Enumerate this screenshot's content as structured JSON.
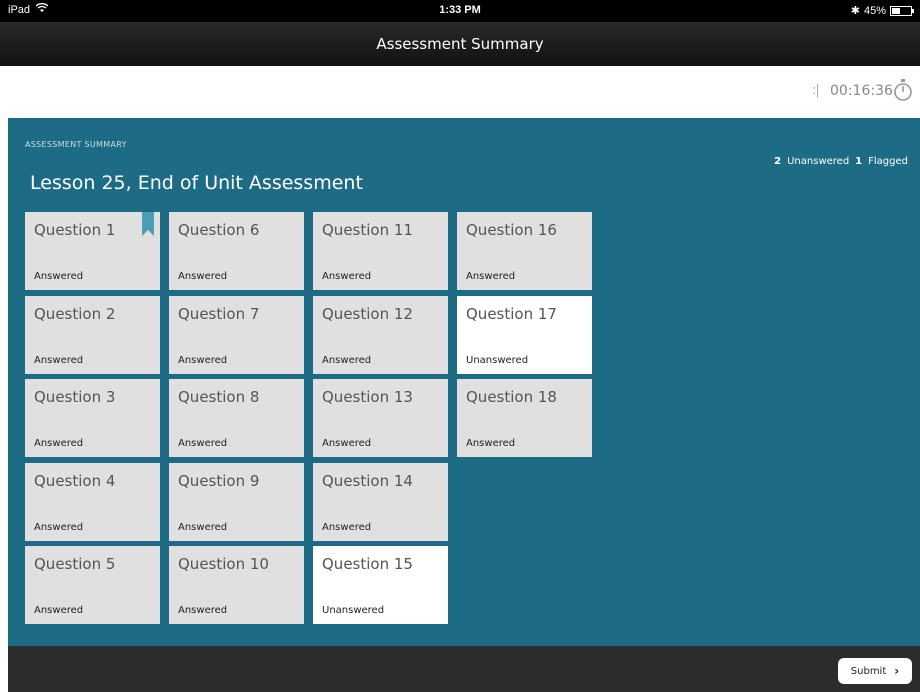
{
  "status_bar": {
    "carrier": "iPad",
    "time": "1:33 PM",
    "battery": "45%",
    "battery_level": 0.45
  },
  "nav": {
    "title": "Assessment Summary"
  },
  "timer": {
    "value": "00:16:36",
    "grip": ":|"
  },
  "main": {
    "section_label": "ASSESSMENT SUMMARY",
    "title": "Lesson 25, End of Unit Assessment",
    "unanswered_count": "2",
    "unanswered_label": "Unanswered",
    "flagged_count": "1",
    "flagged_label": "Flagged"
  },
  "questions": [
    {
      "title": "Question 1",
      "status": "Answered",
      "flagged": true
    },
    {
      "title": "Question 2",
      "status": "Answered"
    },
    {
      "title": "Question 3",
      "status": "Answered"
    },
    {
      "title": "Question 4",
      "status": "Answered"
    },
    {
      "title": "Question 5",
      "status": "Answered"
    },
    {
      "title": "Question 6",
      "status": "Answered"
    },
    {
      "title": "Question 7",
      "status": "Answered"
    },
    {
      "title": "Question 8",
      "status": "Answered"
    },
    {
      "title": "Question 9",
      "status": "Answered"
    },
    {
      "title": "Question 10",
      "status": "Answered"
    },
    {
      "title": "Question 11",
      "status": "Answered"
    },
    {
      "title": "Question 12",
      "status": "Answered"
    },
    {
      "title": "Question 13",
      "status": "Answered"
    },
    {
      "title": "Question 14",
      "status": "Answered"
    },
    {
      "title": "Question 15",
      "status": "Unanswered"
    },
    {
      "title": "Question 16",
      "status": "Answered"
    },
    {
      "title": "Question 17",
      "status": "Unanswered"
    },
    {
      "title": "Question 18",
      "status": "Answered"
    }
  ],
  "footer": {
    "submit_label": "Submit"
  },
  "colors": {
    "main_bg": "#1d6b84",
    "tile_answered": "#e0e0e0",
    "tile_unanswered": "#ffffff",
    "bookmark": "#4a9fb5"
  }
}
